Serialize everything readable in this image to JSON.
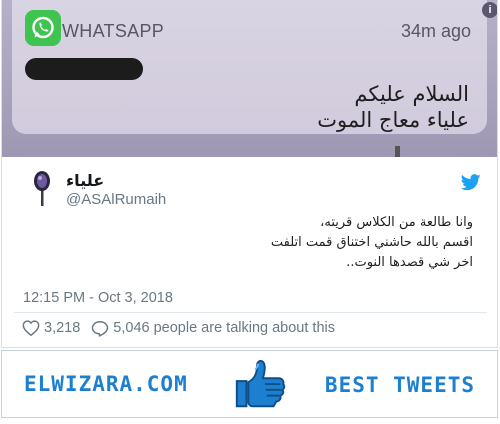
{
  "notification": {
    "app_name": "WHATSAPP",
    "time_ago": "34m ago",
    "info_icon": "info-icon",
    "message_line_1": "السلام عليكم",
    "message_line_2": "علياء معاج الموت",
    "colors": {
      "whatsapp_green": "#3fc351",
      "card_bg": "#d6d0e1"
    }
  },
  "tweet": {
    "display_name": "علياء",
    "handle": "@ASAlRumaih",
    "text_lines": [
      "وانا طالعة من الكلاس قريته،",
      "اقسم بالله حاشني اختناق قمت اتلفت",
      "اخر شي قصدها النوت.."
    ],
    "timestamp": "12:15 PM - Oct 3, 2018",
    "likes": "3,218",
    "replies_text": "5,046 people are talking about this",
    "icons": {
      "brand": "twitter-bird-icon",
      "like": "heart-icon",
      "reply": "comment-icon"
    },
    "colors": {
      "twitter_blue": "#1da1f2",
      "secondary_text": "#697882"
    }
  },
  "footer": {
    "left_text": "ELWIZARA.COM",
    "right_text": "BEST TWEETS",
    "icon": "thumbs-up-icon",
    "colors": {
      "brand_blue": "#1d7fd0"
    }
  }
}
